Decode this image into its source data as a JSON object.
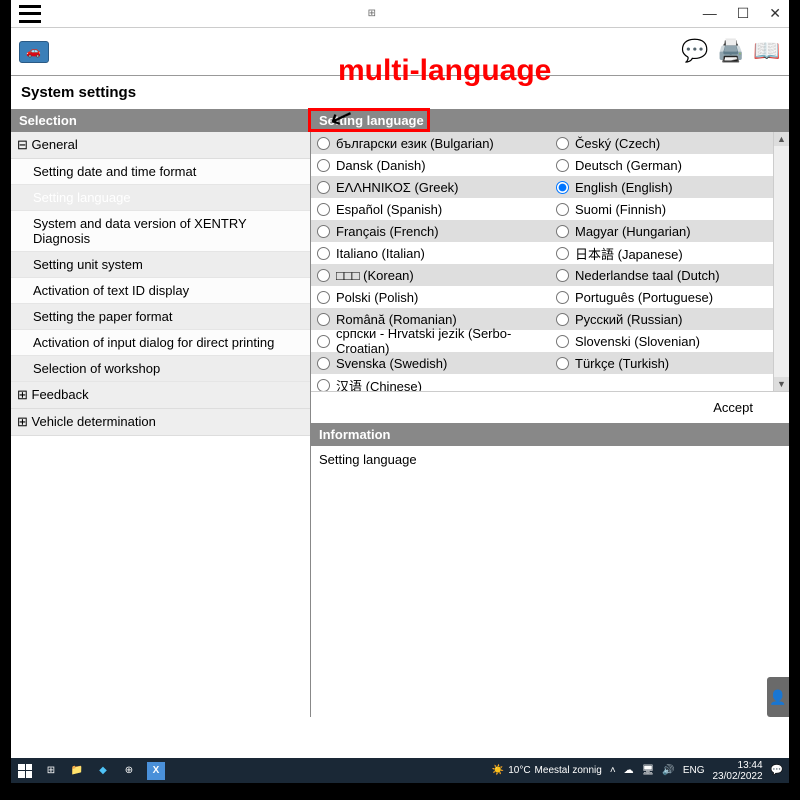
{
  "annotation": "multi-language",
  "titlebar": {
    "center": "⊞"
  },
  "window_controls": {
    "min": "—",
    "max": "☐",
    "close": "✕"
  },
  "page_title": "System settings",
  "sidebar": {
    "header": "Selection",
    "groups": [
      {
        "label": "General",
        "expanded": true,
        "items": [
          "Setting date and time format",
          "Setting language",
          "System and data version of XENTRY Diagnosis",
          "Setting unit system",
          "Activation of text ID display",
          "Setting the paper format",
          "Activation of input dialog for direct printing",
          "Selection of workshop"
        ]
      },
      {
        "label": "Feedback",
        "expanded": false,
        "items": []
      },
      {
        "label": "Vehicle determination",
        "expanded": false,
        "items": []
      }
    ],
    "selected": "Setting language"
  },
  "content": {
    "header": "Setting language",
    "languages": [
      [
        "български език (Bulgarian)",
        "Český (Czech)"
      ],
      [
        "Dansk (Danish)",
        "Deutsch (German)"
      ],
      [
        "ΕΛΛΗΝΙΚΟΣ (Greek)",
        "English (English)"
      ],
      [
        "Español (Spanish)",
        "Suomi (Finnish)"
      ],
      [
        "Français (French)",
        "Magyar (Hungarian)"
      ],
      [
        "Italiano (Italian)",
        "日本語 (Japanese)"
      ],
      [
        "□□□ (Korean)",
        "Nederlandse taal (Dutch)"
      ],
      [
        "Polski (Polish)",
        "Português (Portuguese)"
      ],
      [
        "Română (Romanian)",
        "Русский (Russian)"
      ],
      [
        "српски - Hrvatski jezik (Serbo-Croatian)",
        "Slovenski (Slovenian)"
      ],
      [
        "Svenska (Swedish)",
        "Türkçe (Turkish)"
      ],
      [
        "汉语 (Chinese)",
        ""
      ]
    ],
    "selected_language": "English (English)",
    "accept": "Accept"
  },
  "info": {
    "header": "Information",
    "body": "Setting language"
  },
  "taskbar": {
    "weather": {
      "temp": "10°C",
      "desc": "Meestal zonnig"
    },
    "lang": "ENG",
    "time": "13:44",
    "date": "23/02/2022"
  }
}
